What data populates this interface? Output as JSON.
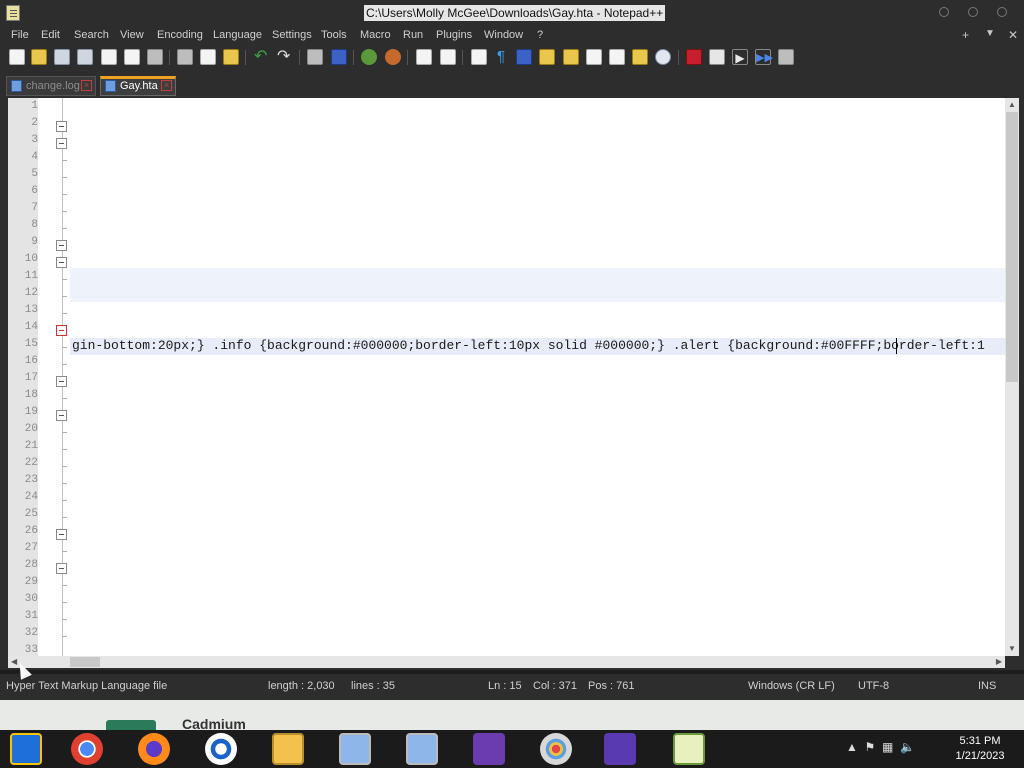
{
  "window": {
    "title": "C:\\Users\\Molly McGee\\Downloads\\Gay.hta - Notepad++"
  },
  "menu": {
    "items": [
      "File",
      "Edit",
      "Search",
      "View",
      "Encoding",
      "Language",
      "Settings",
      "Tools",
      "Macro",
      "Run",
      "Plugins",
      "Window",
      "?"
    ],
    "right": [
      "+",
      "▼",
      "✕"
    ]
  },
  "tabs": [
    {
      "label": "change.log",
      "active": false
    },
    {
      "label": "Gay.hta",
      "active": true
    }
  ],
  "editor": {
    "line_numbers": [
      "1",
      "2",
      "3",
      "4",
      "5",
      "6",
      "7",
      "8",
      "9",
      "10",
      "11",
      "12",
      "13",
      "14",
      "15",
      "16",
      "17",
      "18",
      "19",
      "20",
      "21",
      "22",
      "23",
      "24",
      "25",
      "26",
      "27",
      "28",
      "29",
      "30",
      "31",
      "32",
      "33"
    ],
    "code_line": "gin-bottom:20px;} .info {background:#000000;border-left:10px solid #000000;} .alert {background:#00FFFF;border-left:1",
    "current_line": "15"
  },
  "status": {
    "file_type": "Hyper Text Markup Language file",
    "length": "length : 2,030",
    "lines": "lines : 35",
    "ln": "Ln : 15",
    "col": "Col : 371",
    "pos": "Pos : 761",
    "eol": "Windows (CR LF)",
    "encoding": "UTF-8",
    "mode": "INS"
  },
  "background_window": {
    "text": "Cadmium"
  },
  "taskbar": {
    "apps": [
      "start-icon",
      "chrome-icon",
      "firefox-icon",
      "office-icon",
      "file-explorer-icon",
      "network-tool-icon",
      "network-tool-2-icon",
      "visual-studio-icon",
      "paint-icon",
      "people-icon",
      "notepad-plus-plus-icon"
    ],
    "time": "5:31 PM",
    "date": "1/21/2023"
  },
  "colors": {
    "chrome_dark": "#2d2d2d",
    "editor_bg": "#ffffff",
    "accent_tab": "#f0a020"
  }
}
